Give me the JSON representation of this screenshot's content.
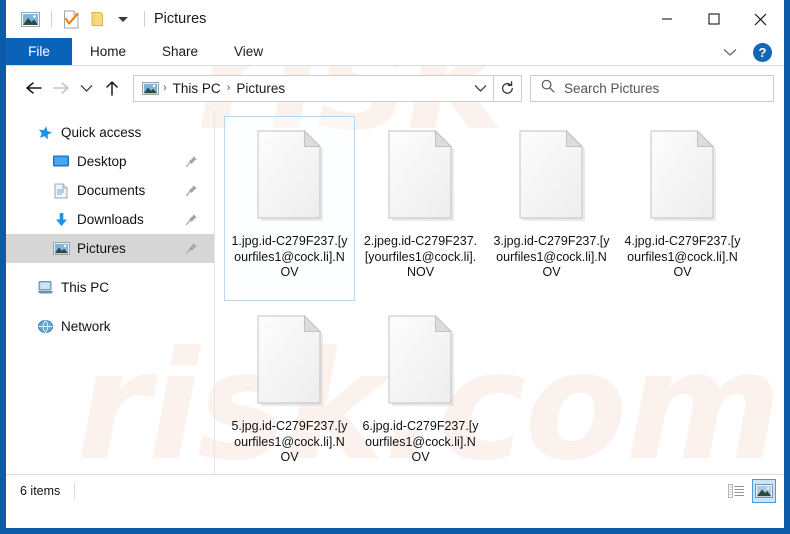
{
  "window": {
    "title": "Pictures",
    "quick_access_icons": [
      "picture-icon",
      "properties-checkmark-icon",
      "new-folder-icon",
      "customize-chevron-icon"
    ],
    "controls": {
      "minimize": "minimize-button",
      "maximize": "maximize-button",
      "close": "close-button"
    }
  },
  "ribbon": {
    "tabs": [
      {
        "label": "File",
        "active": true
      },
      {
        "label": "Home",
        "active": false
      },
      {
        "label": "Share",
        "active": false
      },
      {
        "label": "View",
        "active": false
      }
    ],
    "collapse_icon": "chevron-down-icon",
    "help_label": "?"
  },
  "navigation": {
    "back": "back-arrow-icon",
    "forward": "forward-arrow-icon",
    "recent": "chevron-down-icon",
    "up": "up-arrow-icon",
    "address": {
      "icon": "picture-folder-icon",
      "crumbs": [
        "This PC",
        "Pictures"
      ],
      "separator": "›",
      "dropdown_icon": "chevron-down-icon"
    },
    "refresh_icon": "refresh-icon"
  },
  "search": {
    "icon": "search-icon",
    "placeholder": "Search Pictures",
    "value": ""
  },
  "sidebar": {
    "items": [
      {
        "label": "Quick access",
        "icon": "star-icon",
        "pinned": false,
        "child": false,
        "selected": false
      },
      {
        "label": "Desktop",
        "icon": "desktop-icon",
        "pinned": true,
        "child": true,
        "selected": false
      },
      {
        "label": "Documents",
        "icon": "documents-icon",
        "pinned": true,
        "child": true,
        "selected": false
      },
      {
        "label": "Downloads",
        "icon": "downloads-icon",
        "pinned": true,
        "child": true,
        "selected": false
      },
      {
        "label": "Pictures",
        "icon": "pictures-icon",
        "pinned": true,
        "child": true,
        "selected": true
      },
      {
        "label": "This PC",
        "icon": "this-pc-icon",
        "pinned": false,
        "child": false,
        "selected": false
      },
      {
        "label": "Network",
        "icon": "network-icon",
        "pinned": false,
        "child": false,
        "selected": false
      }
    ]
  },
  "files": [
    {
      "name": "1.jpg.id-C279F237.[yourfiles1@cock.li].NOV",
      "icon": "blank-document-icon",
      "selected": true
    },
    {
      "name": "2.jpeg.id-C279F237.[yourfiles1@cock.li].NOV",
      "icon": "blank-document-icon",
      "selected": false
    },
    {
      "name": "3.jpg.id-C279F237.[yourfiles1@cock.li].NOV",
      "icon": "blank-document-icon",
      "selected": false
    },
    {
      "name": "4.jpg.id-C279F237.[yourfiles1@cock.li].NOV",
      "icon": "blank-document-icon",
      "selected": false
    },
    {
      "name": "5.jpg.id-C279F237.[yourfiles1@cock.li].NOV",
      "icon": "blank-document-icon",
      "selected": false
    },
    {
      "name": "6.jpg.id-C279F237.[yourfiles1@cock.li].NOV",
      "icon": "blank-document-icon",
      "selected": false
    }
  ],
  "statusbar": {
    "item_count": "6 items",
    "views": [
      {
        "name": "details-view-button",
        "active": false
      },
      {
        "name": "large-icons-view-button",
        "active": true
      }
    ]
  },
  "watermark": {
    "line1": "risk",
    "line2": "risk.com"
  },
  "colors": {
    "frame_blue": "#0c5ba8",
    "file_tab_blue": "#0a63b8",
    "selection_border": "#bdd7ef",
    "sidebar_selected": "#d6d6d6",
    "accent_blue": "#1267b5"
  }
}
